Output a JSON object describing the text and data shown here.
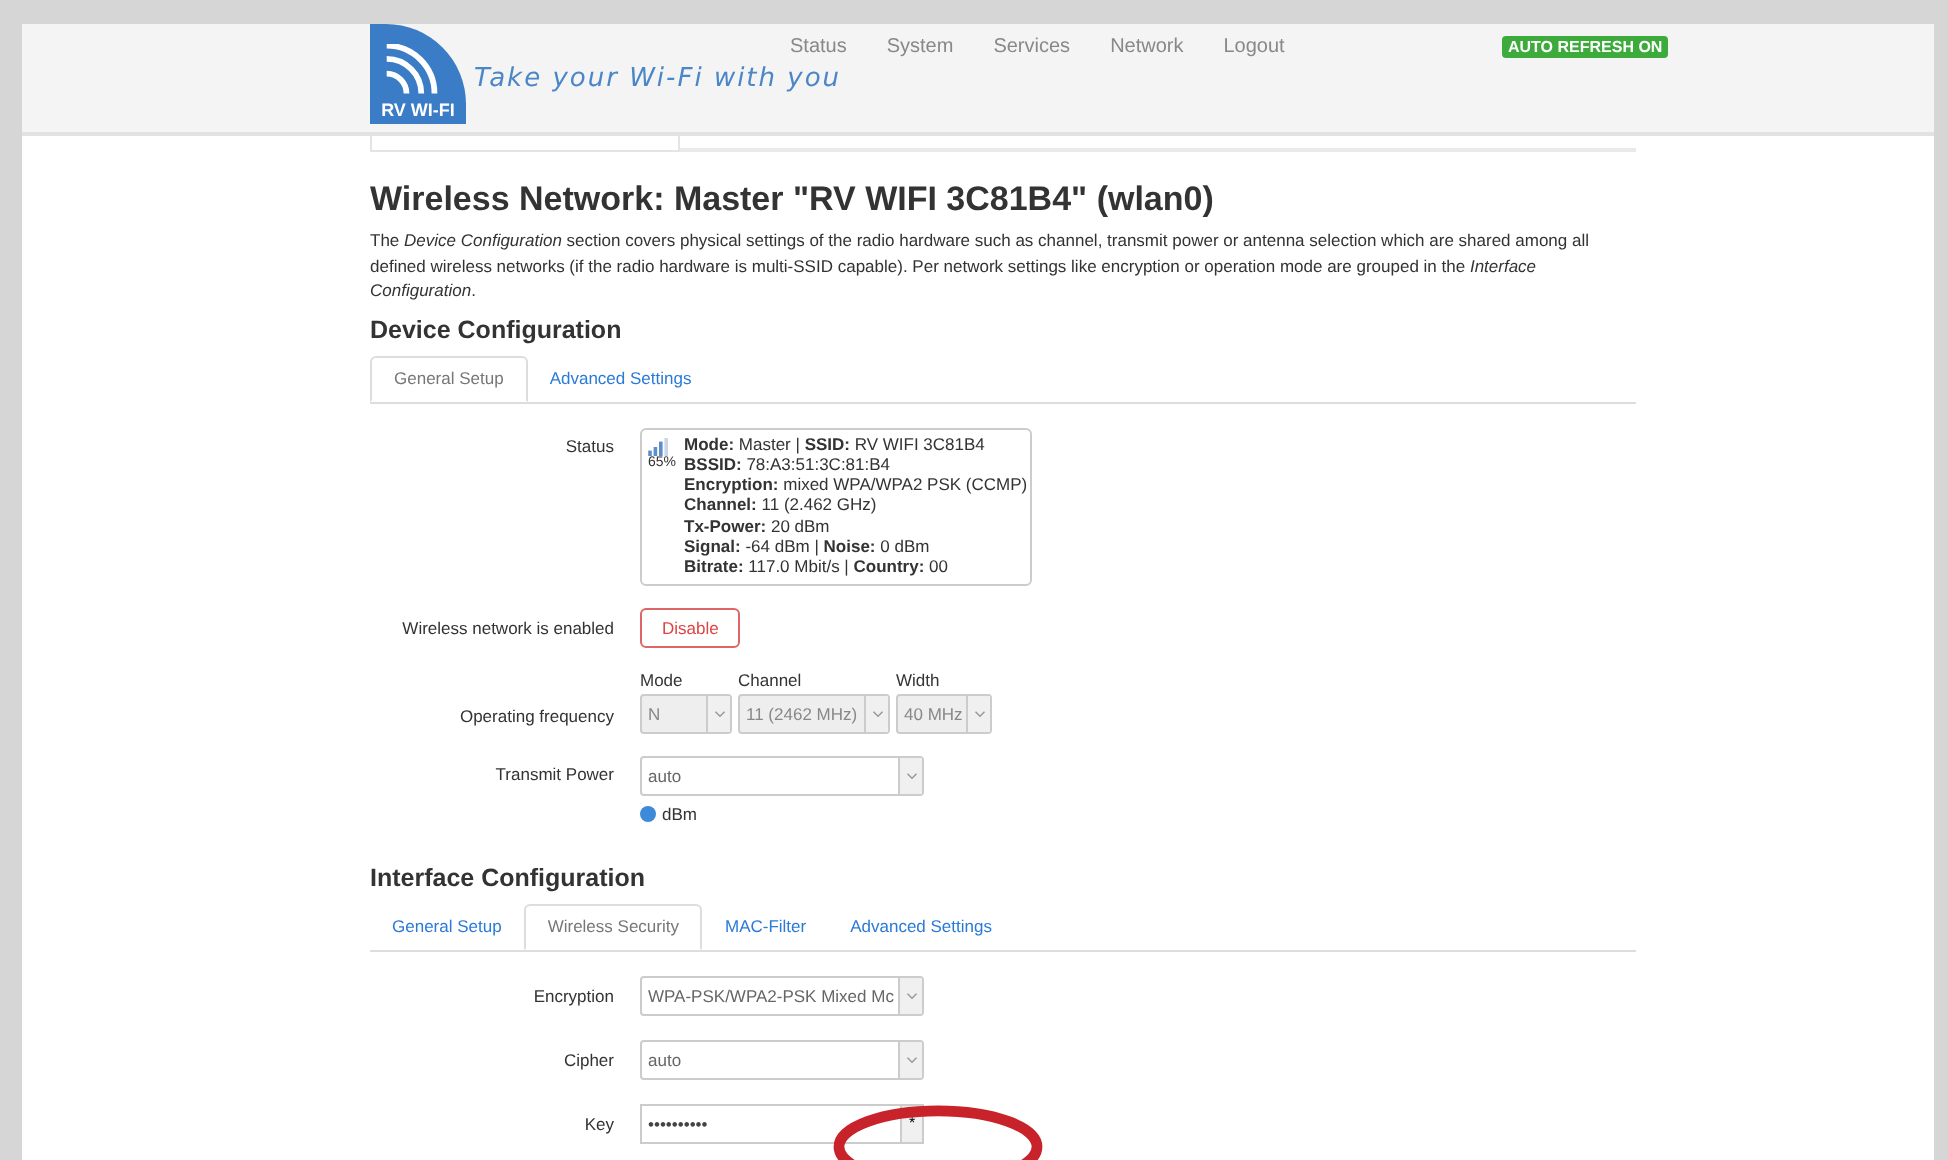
{
  "header": {
    "logo_text": "RV WI-FI",
    "tagline": "Take your Wi-Fi with you",
    "nav": [
      "Status",
      "System",
      "Services",
      "Network",
      "Logout"
    ],
    "auto_refresh": {
      "label": "AUTO REFRESH ON",
      "on": true
    }
  },
  "page": {
    "title": "Wireless Network: Master \"RV WIFI 3C81B4\" (wlan0)",
    "description": "The *Device Configuration* section covers physical settings of the radio hardware such as channel, transmit power or antenna selection which are shared among all defined wireless networks (if the radio hardware is multi-SSID capable). Per network settings like encryption or operation mode are grouped in the *Interface Configuration*."
  },
  "device_config": {
    "heading": "Device Configuration",
    "tabs": [
      {
        "label": "General Setup",
        "selected": true
      },
      {
        "label": "Advanced Settings",
        "selected": false
      }
    ],
    "status": {
      "label": "Status",
      "signal": "65%",
      "lines": [
        "**Mode:** Master | **SSID:** RV WIFI 3C81B4",
        "**BSSID:** 78:A3:51:3C:81:B4",
        "**Encryption:** mixed WPA/WPA2 PSK (CCMP)",
        "**Channel:** 11 (2.462 GHz)",
        "**Tx-Power:** 20 dBm",
        "**Signal:** -64 dBm | **Noise:** 0 dBm",
        "**Bitrate:** 117.0 Mbit/s | **Country:** 00"
      ]
    },
    "enable": {
      "label": "Wireless network is enabled",
      "button": "Disable"
    },
    "frequency": {
      "label": "Operating frequency",
      "fields": [
        {
          "caption": "Mode",
          "value": "N",
          "disabled": true
        },
        {
          "caption": "Channel",
          "value": "11 (2462 MHz)",
          "disabled": true
        },
        {
          "caption": "Width",
          "value": "40 MHz",
          "disabled": true
        }
      ]
    },
    "transmit_power": {
      "label": "Transmit Power",
      "value": "auto",
      "hint": "dBm"
    }
  },
  "interface_config": {
    "heading": "Interface Configuration",
    "tabs": [
      {
        "label": "General Setup",
        "selected": false
      },
      {
        "label": "Wireless Security",
        "selected": true
      },
      {
        "label": "MAC-Filter",
        "selected": false
      },
      {
        "label": "Advanced Settings",
        "selected": false
      }
    ],
    "fields": [
      {
        "label": "Encryption",
        "kind": "select",
        "value": "WPA-PSK/WPA2-PSK Mixed Mc"
      },
      {
        "label": "Cipher",
        "kind": "select",
        "value": "auto"
      },
      {
        "label": "Key",
        "kind": "password",
        "value": "••••••••••",
        "button": "*"
      }
    ]
  }
}
